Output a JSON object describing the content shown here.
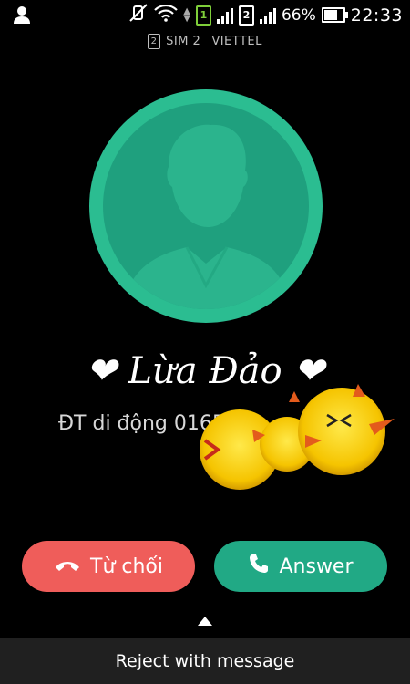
{
  "status_bar": {
    "sim1_label": "1",
    "sim2_label": "2",
    "battery": "66%",
    "battery_level": 0.66,
    "time": "22:33"
  },
  "sim_info": {
    "sim_number": "2",
    "sim_text": "SIM 2",
    "carrier": "VIETTEL"
  },
  "caller": {
    "name": "❤ Lừa Đảo ❤",
    "number_label": "ĐT di động 0165"
  },
  "actions": {
    "reject_label": "Từ chối",
    "answer_label": "Answer"
  },
  "bottom": {
    "reject_message_label": "Reject with message"
  },
  "colors": {
    "reject": "#ef5d5a",
    "answer": "#21a985",
    "avatar": "#2bbd91"
  }
}
